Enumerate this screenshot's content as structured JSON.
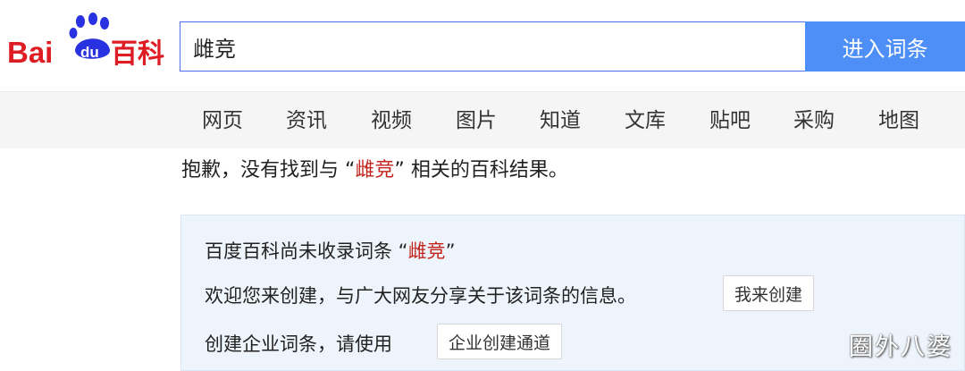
{
  "brand": {
    "logo_text_left": "Bai",
    "logo_text_paw": "du",
    "logo_text_right": "百科",
    "colors": {
      "red": "#de1c23",
      "blue": "#2932e1",
      "accent": "#4e8ef7",
      "highlight": "#c1221b"
    }
  },
  "search": {
    "value": "雌竞",
    "button_label": "进入词条"
  },
  "nav": {
    "items": [
      {
        "label": "网页"
      },
      {
        "label": "资讯"
      },
      {
        "label": "视频"
      },
      {
        "label": "图片"
      },
      {
        "label": "知道"
      },
      {
        "label": "文库"
      },
      {
        "label": "贴吧"
      },
      {
        "label": "采购"
      },
      {
        "label": "地图"
      }
    ]
  },
  "message": {
    "prefix": "抱歉，没有找到与 “",
    "keyword": "雌竞",
    "suffix": "” 相关的百科结果。"
  },
  "panel": {
    "line1_prefix": "百度百科尚未收录词条 “",
    "line1_keyword": "雌竞",
    "line1_suffix": "”",
    "line2_text": "欢迎您来创建，与广大网友分享关于该词条的信息。",
    "create_button": "我来创建",
    "line3_text": "创建企业词条，请使用",
    "enterprise_button": "企业创建通道"
  },
  "watermark": "圈外八婆"
}
